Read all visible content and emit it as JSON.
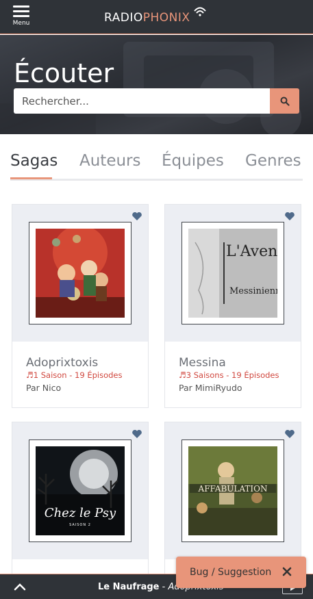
{
  "header": {
    "menu_label": "Menu",
    "logo_part1": "RADIO",
    "logo_part2": "PHONIX",
    "menu_icon": "hamburger-icon",
    "logo_icon": "radio-waves-icon"
  },
  "hero": {
    "title": "Écouter",
    "search_placeholder": "Rechercher...",
    "search_icon": "search-icon"
  },
  "tabs": [
    {
      "label": "Sagas",
      "active": true
    },
    {
      "label": "Auteurs",
      "active": false
    },
    {
      "label": "Équipes",
      "active": false
    },
    {
      "label": "Genres",
      "active": false
    }
  ],
  "cards": [
    {
      "title": "Adoprixtoxis",
      "meta": "1 Saison - 19 Épisodes",
      "author": "Par Nico"
    },
    {
      "title": "Messina",
      "meta": "3 Saisons - 19 Épisodes",
      "author": "Par MimiRyudo"
    },
    {
      "title": "Chez le Psy",
      "meta": "",
      "author": "",
      "cover_text": "Chez le Psy",
      "cover_subtext": "SAISON 2"
    },
    {
      "title": "Affabulation",
      "meta": "",
      "author": "",
      "cover_text": "AFFABULATION"
    }
  ],
  "cover_texts": {
    "messina_line1": "L'Aventure",
    "messina_line2": "Messinienne"
  },
  "player": {
    "episode": "Le Naufrage",
    "separator": " - ",
    "saga": "Adoprixtoxis",
    "expand_icon": "chevron-up-icon",
    "play_icon": "play-icon"
  },
  "toast": {
    "label": "Bug / Suggestion",
    "close_icon": "close-icon"
  },
  "colors": {
    "accent": "#e8957a",
    "topbar": "#2f3338",
    "meta_red": "#d0473e",
    "heart": "#4f6a8a"
  }
}
